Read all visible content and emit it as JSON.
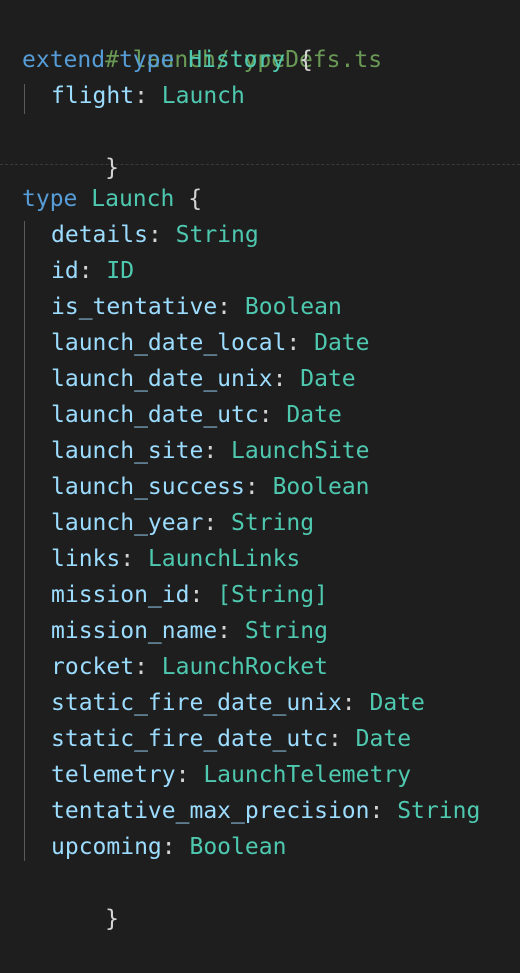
{
  "file_comment": "# launch/typeDefs.ts",
  "extend_block": {
    "keyword_extend": "extend",
    "keyword_type": "type",
    "type_name": "History",
    "open_brace": "{",
    "close_brace": "}",
    "fields": [
      {
        "name": "flight",
        "type": "Launch"
      }
    ]
  },
  "launch_block": {
    "keyword_type": "type",
    "type_name": "Launch",
    "open_brace": "{",
    "close_brace": "}",
    "fields": [
      {
        "name": "details",
        "type": "String"
      },
      {
        "name": "id",
        "type": "ID"
      },
      {
        "name": "is_tentative",
        "type": "Boolean"
      },
      {
        "name": "launch_date_local",
        "type": "Date"
      },
      {
        "name": "launch_date_unix",
        "type": "Date"
      },
      {
        "name": "launch_date_utc",
        "type": "Date"
      },
      {
        "name": "launch_site",
        "type": "LaunchSite"
      },
      {
        "name": "launch_success",
        "type": "Boolean"
      },
      {
        "name": "launch_year",
        "type": "String"
      },
      {
        "name": "links",
        "type": "LaunchLinks"
      },
      {
        "name": "mission_id",
        "type": "[String]"
      },
      {
        "name": "mission_name",
        "type": "String"
      },
      {
        "name": "rocket",
        "type": "LaunchRocket"
      },
      {
        "name": "static_fire_date_unix",
        "type": "Date"
      },
      {
        "name": "static_fire_date_utc",
        "type": "Date"
      },
      {
        "name": "telemetry",
        "type": "LaunchTelemetry"
      },
      {
        "name": "tentative_max_precision",
        "type": "String"
      },
      {
        "name": "upcoming",
        "type": "Boolean"
      }
    ]
  },
  "colors": {
    "background": "#1e1e1e",
    "comment": "#6a9955",
    "keyword": "#569cd6",
    "type": "#4ec9b0",
    "property": "#9cdcfe",
    "punctuation": "#d4d4d4"
  }
}
